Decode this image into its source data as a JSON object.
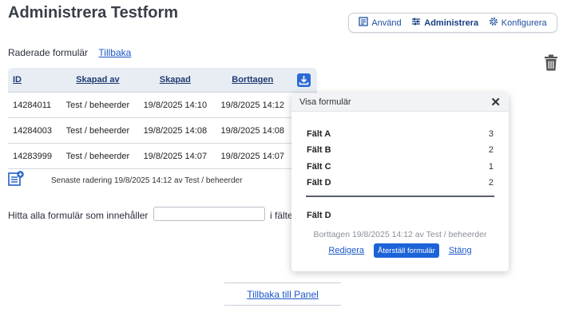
{
  "page": {
    "title": "Administrera Testform"
  },
  "nav": {
    "items": [
      {
        "label": "Använd",
        "icon": "form-icon"
      },
      {
        "label": "Administrera",
        "icon": "sliders-icon",
        "active": true
      },
      {
        "label": "Konfigurera",
        "icon": "gear-icon"
      }
    ]
  },
  "subheader": {
    "label": "Raderade formulär",
    "back_link": "Tillbaka"
  },
  "table": {
    "headers": [
      "ID",
      "Skapad av",
      "Skapad",
      "Borttagen"
    ],
    "rows": [
      [
        "14284011",
        "Test / beheerder",
        "19/8/2025 14:10",
        "19/8/2025 14:12"
      ],
      [
        "14284003",
        "Test / beheerder",
        "19/8/2025 14:08",
        "19/8/2025 14:08"
      ],
      [
        "14283999",
        "Test / beheerder",
        "19/8/2025 14:07",
        "19/8/2025 14:07"
      ]
    ]
  },
  "last_deletion": "Senaste radering 19/8/2025 14:12 av Test / beheerder",
  "search": {
    "label": "Hitta alla formulär som innehåller",
    "value": "",
    "tail": "i fälte"
  },
  "footer": {
    "link": "Tillbaka till Panel"
  },
  "modal": {
    "title": "Visa formulär",
    "fields": [
      {
        "name": "Fält A",
        "value": "3"
      },
      {
        "name": "Fält B",
        "value": "2"
      },
      {
        "name": "Fält C",
        "value": "1"
      },
      {
        "name": "Fält D",
        "value": "2"
      }
    ],
    "detail_field": "Fält D",
    "deleted_info": "Borttagen 19/8/2025 14:12 av Test / beheerder",
    "edit_label": "Redigera",
    "restore_label": "Återställ formulär",
    "close_label": "Stäng"
  },
  "colors": {
    "accent": "#1c63d8",
    "link": "#1a56c9",
    "header_bg": "#e8edf4"
  }
}
